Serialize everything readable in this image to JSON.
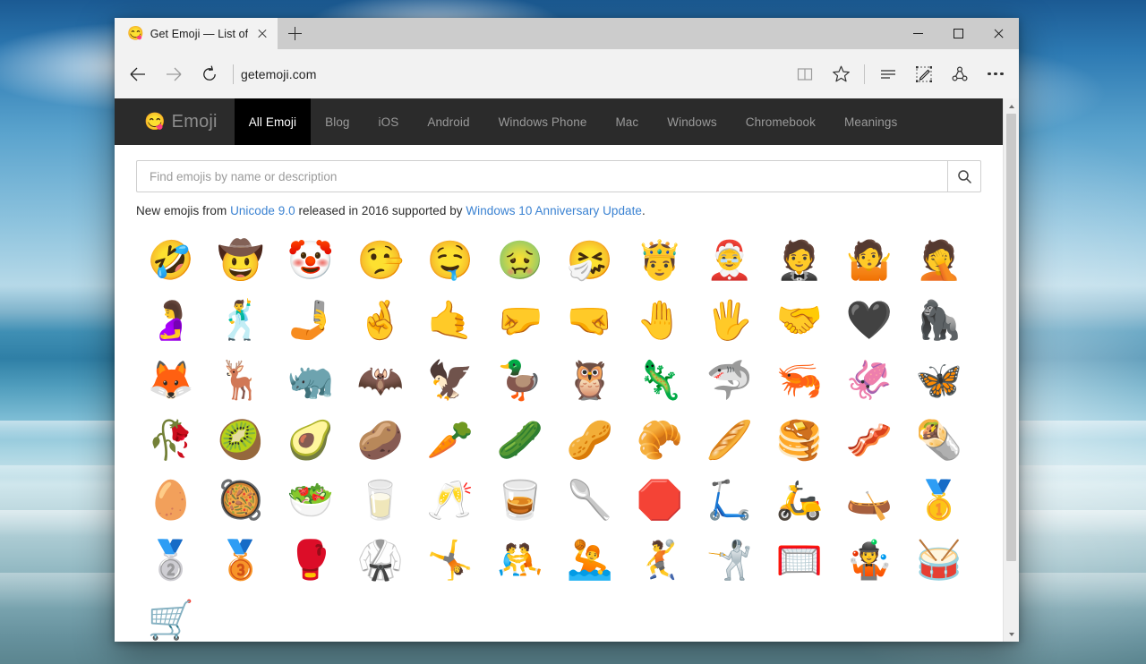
{
  "window": {
    "controls": {
      "minimize": "minimize",
      "maximize": "maximize",
      "close": "close"
    }
  },
  "browser": {
    "tabs": [
      {
        "favicon": "😋",
        "title": "Get Emoji — List of",
        "close_label": "Close tab"
      }
    ],
    "new_tab_label": "New tab",
    "nav": {
      "back": "Back",
      "forward": "Forward",
      "refresh": "Refresh",
      "address": "getemoji.com"
    },
    "toolbar": {
      "reading_view": "reading-view",
      "favorites": "favorites",
      "hub": "hub",
      "web_note": "web-note",
      "share": "share",
      "more": "more"
    }
  },
  "site": {
    "brand": {
      "emoji": "😋",
      "text": "Emoji"
    },
    "nav_items": [
      {
        "label": "All Emoji",
        "active": true
      },
      {
        "label": "Blog",
        "active": false
      },
      {
        "label": "iOS",
        "active": false
      },
      {
        "label": "Android",
        "active": false
      },
      {
        "label": "Windows Phone",
        "active": false
      },
      {
        "label": "Mac",
        "active": false
      },
      {
        "label": "Windows",
        "active": false
      },
      {
        "label": "Chromebook",
        "active": false
      },
      {
        "label": "Meanings",
        "active": false
      }
    ],
    "search": {
      "placeholder": "Find emojis by name or description",
      "value": "",
      "button_icon": "search-icon"
    },
    "blurb": {
      "part1": "New emojis from ",
      "link1": "Unicode 9.0",
      "part2": " released in 2016 supported by ",
      "link2": "Windows 10 Anniversary Update",
      "part3": "."
    },
    "emojis": [
      {
        "char": "🤣",
        "name": "rolling-on-the-floor-laughing"
      },
      {
        "char": "🤠",
        "name": "cowboy-hat-face"
      },
      {
        "char": "🤡",
        "name": "clown-face"
      },
      {
        "char": "🤥",
        "name": "lying-face"
      },
      {
        "char": "🤤",
        "name": "drooling-face"
      },
      {
        "char": "🤢",
        "name": "nauseated-face"
      },
      {
        "char": "🤧",
        "name": "sneezing-face"
      },
      {
        "char": "🤴",
        "name": "prince"
      },
      {
        "char": "🤶",
        "name": "mrs-claus"
      },
      {
        "char": "🤵",
        "name": "man-in-tuxedo"
      },
      {
        "char": "🤷",
        "name": "person-shrugging"
      },
      {
        "char": "🤦",
        "name": "person-facepalming"
      },
      {
        "char": "🤰",
        "name": "pregnant-woman"
      },
      {
        "char": "🕺",
        "name": "man-dancing"
      },
      {
        "char": "🤳",
        "name": "selfie"
      },
      {
        "char": "🤞",
        "name": "crossed-fingers"
      },
      {
        "char": "🤙",
        "name": "call-me-hand"
      },
      {
        "char": "🤛",
        "name": "left-facing-fist"
      },
      {
        "char": "🤜",
        "name": "right-facing-fist"
      },
      {
        "char": "🤚",
        "name": "raised-back-of-hand"
      },
      {
        "char": "🖐",
        "name": "hand-with-fingers-splayed"
      },
      {
        "char": "🤝",
        "name": "handshake"
      },
      {
        "char": "🖤",
        "name": "black-heart"
      },
      {
        "char": "🦍",
        "name": "gorilla"
      },
      {
        "char": "🦊",
        "name": "fox-face"
      },
      {
        "char": "🦌",
        "name": "deer"
      },
      {
        "char": "🦏",
        "name": "rhinoceros"
      },
      {
        "char": "🦇",
        "name": "bat"
      },
      {
        "char": "🦅",
        "name": "eagle"
      },
      {
        "char": "🦆",
        "name": "duck"
      },
      {
        "char": "🦉",
        "name": "owl"
      },
      {
        "char": "🦎",
        "name": "lizard"
      },
      {
        "char": "🦈",
        "name": "shark"
      },
      {
        "char": "🦐",
        "name": "shrimp"
      },
      {
        "char": "🦑",
        "name": "squid"
      },
      {
        "char": "🦋",
        "name": "butterfly"
      },
      {
        "char": "🥀",
        "name": "wilted-flower"
      },
      {
        "char": "🥝",
        "name": "kiwi-fruit"
      },
      {
        "char": "🥑",
        "name": "avocado"
      },
      {
        "char": "🥔",
        "name": "potato"
      },
      {
        "char": "🥕",
        "name": "carrot"
      },
      {
        "char": "🥒",
        "name": "cucumber"
      },
      {
        "char": "🥜",
        "name": "peanuts"
      },
      {
        "char": "🥐",
        "name": "croissant"
      },
      {
        "char": "🥖",
        "name": "baguette-bread"
      },
      {
        "char": "🥞",
        "name": "pancakes"
      },
      {
        "char": "🥓",
        "name": "bacon"
      },
      {
        "char": "🌯",
        "name": "burrito"
      },
      {
        "char": "🥚",
        "name": "egg"
      },
      {
        "char": "🥘",
        "name": "shallow-pan-of-food"
      },
      {
        "char": "🥗",
        "name": "green-salad"
      },
      {
        "char": "🥛",
        "name": "glass-of-milk"
      },
      {
        "char": "🥂",
        "name": "clinking-glasses"
      },
      {
        "char": "🥃",
        "name": "tumbler-glass"
      },
      {
        "char": "🥄",
        "name": "spoon"
      },
      {
        "char": "🛑",
        "name": "stop-sign"
      },
      {
        "char": "🛴",
        "name": "kick-scooter"
      },
      {
        "char": "🛵",
        "name": "motor-scooter"
      },
      {
        "char": "🛶",
        "name": "canoe"
      },
      {
        "char": "🥇",
        "name": "1st-place-medal"
      },
      {
        "char": "🥈",
        "name": "2nd-place-medal"
      },
      {
        "char": "🥉",
        "name": "3rd-place-medal"
      },
      {
        "char": "🥊",
        "name": "boxing-glove"
      },
      {
        "char": "🥋",
        "name": "martial-arts-uniform"
      },
      {
        "char": "🤸",
        "name": "person-cartwheeling"
      },
      {
        "char": "🤼",
        "name": "people-wrestling"
      },
      {
        "char": "🤽",
        "name": "person-playing-water-polo"
      },
      {
        "char": "🤾",
        "name": "person-playing-handball"
      },
      {
        "char": "🤺",
        "name": "person-fencing"
      },
      {
        "char": "🥅",
        "name": "goal-net"
      },
      {
        "char": "🤹",
        "name": "person-juggling"
      },
      {
        "char": "🥁",
        "name": "drum"
      },
      {
        "char": "🛒",
        "name": "shopping-cart"
      }
    ]
  },
  "colors": {
    "nav_bg": "#2b2b2b",
    "nav_active_bg": "#000000",
    "link": "#3a82d2",
    "chrome_bg": "#f2f2f2",
    "titlebar_bg": "#cccccc"
  }
}
